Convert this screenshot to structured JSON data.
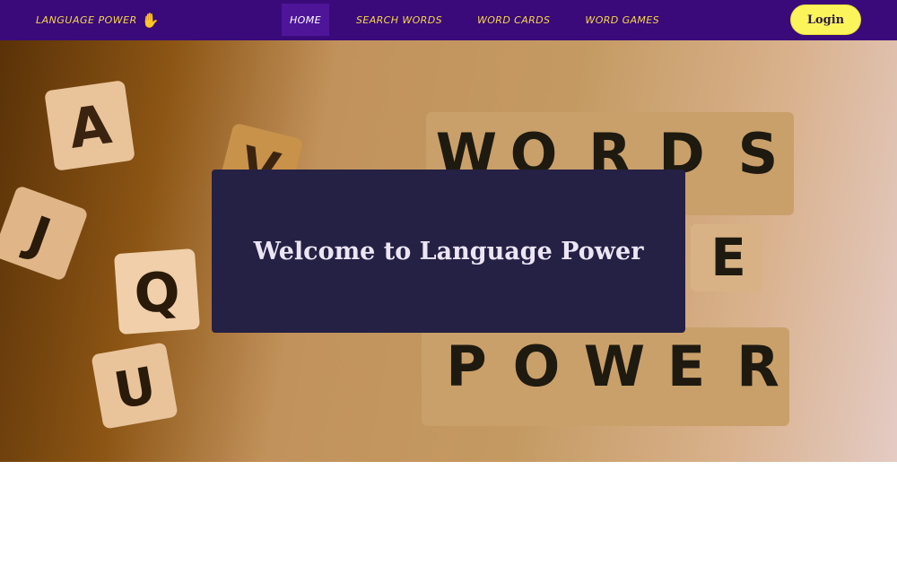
{
  "navbar": {
    "brand": "LANGUAGE POWER",
    "brand_icon": "waving-hand-icon",
    "links": [
      {
        "label": "HOME",
        "active": true
      },
      {
        "label": "SEARCH WORDS",
        "active": false
      },
      {
        "label": "WORD CARDS",
        "active": false
      },
      {
        "label": "WORD GAMES",
        "active": false
      }
    ],
    "login_label": "Login"
  },
  "hero": {
    "title": "Welcome to Language Power",
    "tiles_left": [
      "A",
      "V",
      "Q",
      "U",
      "J"
    ],
    "tiles_words": [
      "W",
      "O",
      "R",
      "D",
      "S",
      "E",
      "P",
      "O",
      "W",
      "E",
      "R"
    ]
  },
  "colors": {
    "navbar": "#3a0a7a",
    "nav_text": "#f5d64a",
    "login_button": "#fbf55b",
    "welcome_box": "#252144"
  }
}
